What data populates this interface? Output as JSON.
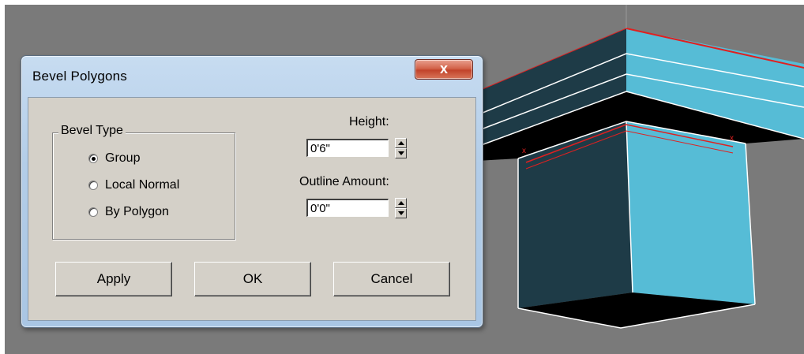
{
  "dialog": {
    "title": "Bevel Polygons",
    "close_glyph": "x",
    "bevel_type": {
      "legend": "Bevel Type",
      "options": [
        {
          "label": "Group",
          "checked": true
        },
        {
          "label": "Local Normal",
          "checked": false
        },
        {
          "label": "By Polygon",
          "checked": false
        }
      ]
    },
    "height": {
      "label": "Height:",
      "value": "0'6\""
    },
    "outline": {
      "label": "Outline Amount:",
      "value": "0'0\""
    },
    "buttons": {
      "apply": "Apply",
      "ok": "OK",
      "cancel": "Cancel"
    }
  },
  "colors": {
    "viewport_bg": "#7a7a7a",
    "face_dark": "#1e3b47",
    "face_light": "#56bcd6",
    "edge_selected": "#e02020",
    "edge": "#ffffff"
  }
}
